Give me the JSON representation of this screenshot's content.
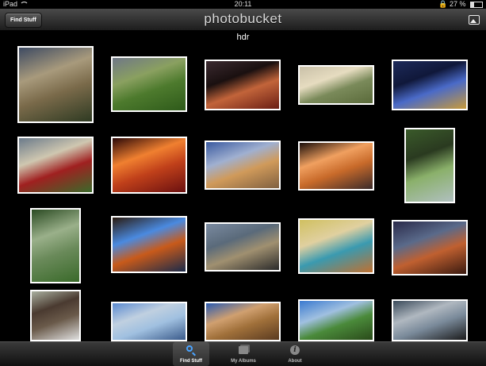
{
  "status": {
    "device": "iPad",
    "time": "20:11",
    "battery": "27 %",
    "battery_level": 0.27
  },
  "nav": {
    "back_label": "Find Stuff",
    "brand": "photobucket",
    "right_icon": "photo-icon"
  },
  "search": {
    "term": "hdr"
  },
  "photos": [
    {
      "colors": [
        "#3d4a62",
        "#7a6a4a",
        "#2e3a22",
        "#a89a7c"
      ]
    },
    {
      "colors": [
        "#6f7787",
        "#4d7a2d",
        "#2e5a1a",
        "#8aa060"
      ]
    },
    {
      "colors": [
        "#3b2a30",
        "#c2643a",
        "#6a1e14",
        "#1a1010"
      ]
    },
    {
      "colors": [
        "#c9c0a8",
        "#7a8a5a",
        "#5a6a3a",
        "#e6dcc0"
      ]
    },
    {
      "colors": [
        "#1d2a5a",
        "#4a6ac8",
        "#c89a3a",
        "#10183a"
      ]
    },
    {
      "colors": [
        "#6a7a8a",
        "#a02020",
        "#3a6a2a",
        "#cfc7b0"
      ]
    },
    {
      "colors": [
        "#2a0808",
        "#c0401a",
        "#6a1010",
        "#f08030"
      ]
    },
    {
      "colors": [
        "#3a5aa0",
        "#d09a5a",
        "#806040",
        "#a0b0d0"
      ]
    },
    {
      "colors": [
        "#1a0e0a",
        "#c86a2a",
        "#3a2a2a",
        "#f0a060"
      ]
    },
    {
      "colors": [
        "#3a5a2a",
        "#8ab06a",
        "#b0c0c0",
        "#2a3a20"
      ]
    },
    {
      "colors": [
        "#2a4a22",
        "#6a8a5a",
        "#3a6a2a",
        "#9ab08a"
      ]
    },
    {
      "colors": [
        "#2a1a0e",
        "#c85a1a",
        "#1a2a4a",
        "#4a8ae0"
      ]
    },
    {
      "colors": [
        "#7a8aa0",
        "#a09070",
        "#2a2a2a",
        "#5a6a7a"
      ]
    },
    {
      "colors": [
        "#d0c060",
        "#3a9ab0",
        "#c07030",
        "#e0d0a0"
      ]
    },
    {
      "colors": [
        "#2a2a4a",
        "#c06030",
        "#3a1a10",
        "#5a6a8a"
      ]
    },
    {
      "colors": [
        "#aab0a0",
        "#6a5a4a",
        "#e0e0e0",
        "#4a3a30"
      ]
    },
    {
      "colors": [
        "#5a8ad0",
        "#a0c0e0",
        "#3a5a8a",
        "#c0d0e0"
      ]
    },
    {
      "colors": [
        "#2a5ab0",
        "#a0703a",
        "#5a3a20",
        "#d0a070"
      ]
    },
    {
      "colors": [
        "#3a7ad0",
        "#4a8a3a",
        "#2a4a1a",
        "#a0c0e0"
      ]
    },
    {
      "colors": [
        "#3a4a5a",
        "#7a8a9a",
        "#1a1a1a",
        "#b0b8c0"
      ]
    }
  ],
  "tabs": [
    {
      "label": "Find Stuff",
      "icon": "magnifier-icon",
      "active": true
    },
    {
      "label": "My Albums",
      "icon": "albums-icon",
      "active": false
    },
    {
      "label": "About",
      "icon": "info-icon",
      "active": false
    }
  ]
}
